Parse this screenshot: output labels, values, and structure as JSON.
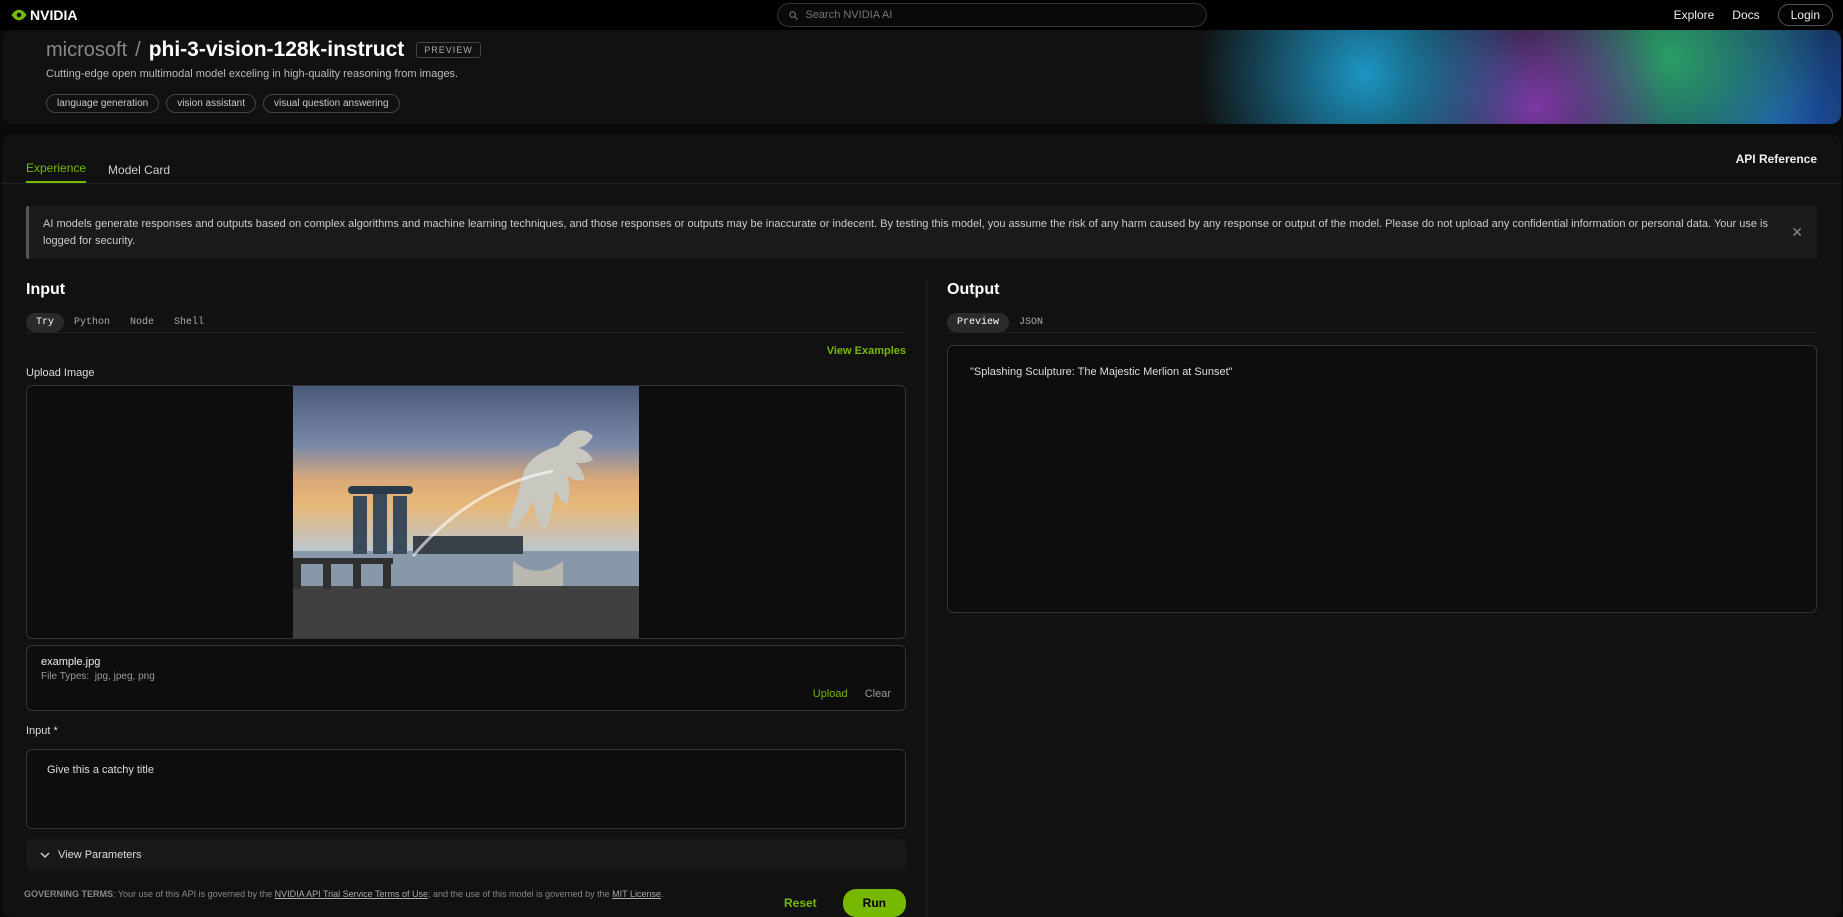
{
  "topbar": {
    "search_placeholder": "Search NVIDIA AI",
    "explore": "Explore",
    "docs": "Docs",
    "login": "Login",
    "logo_text": "NVIDIA"
  },
  "header": {
    "org": "microsoft",
    "sep": "/",
    "name": "phi-3-vision-128k-instruct",
    "badge": "PREVIEW",
    "subtitle": "Cutting-edge open multimodal model exceling in high-quality reasoning from images.",
    "tags": [
      "language generation",
      "vision assistant",
      "visual question answering"
    ]
  },
  "tabs": {
    "experience": "Experience",
    "model_card": "Model Card",
    "api_reference": "API Reference"
  },
  "alert": {
    "text": "AI models generate responses and outputs based on complex algorithms and machine learning techniques, and those responses or outputs may be inaccurate or indecent. By testing this model, you assume the risk of any harm caused by any response or output of the model. Please do not upload any confidential information or personal data. Your use is logged for security."
  },
  "input": {
    "title": "Input",
    "code_tabs": [
      "Try",
      "Python",
      "Node",
      "Shell"
    ],
    "view_examples": "View Examples",
    "upload_label": "Upload Image",
    "file_name": "example.jpg",
    "file_types_label": "File Types:",
    "file_types": "jpg,  jpeg,  png",
    "upload_action": "Upload",
    "clear_action": "Clear",
    "input_label": "Input",
    "input_value": "Give this a catchy title",
    "view_parameters": "View Parameters",
    "reset": "Reset",
    "run": "Run"
  },
  "output": {
    "title": "Output",
    "tabs": [
      "Preview",
      "JSON"
    ],
    "text": "\"Splashing Sculpture: The Majestic Merlion at Sunset\""
  },
  "footer": {
    "prefix": "GOVERNING TERMS",
    "mid1": ": Your use of this API is governed by the ",
    "link1": "NVIDIA API Trial Service Terms of Use",
    "mid2": "; and the use of this model is governed by the ",
    "link2": "MIT License",
    "end": "."
  }
}
